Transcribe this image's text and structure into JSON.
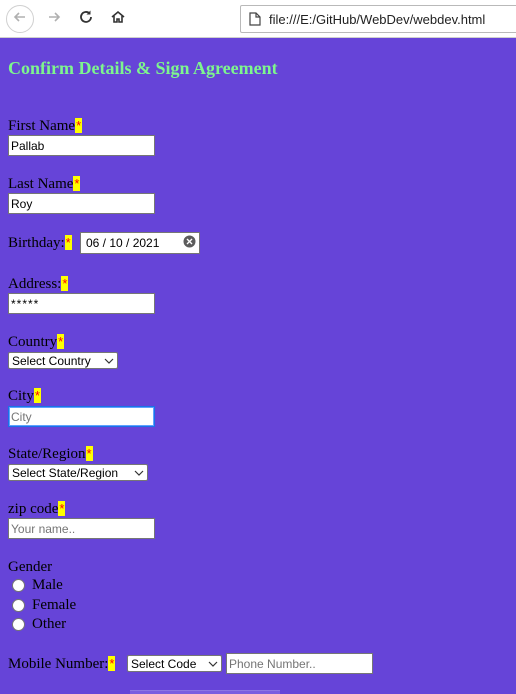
{
  "browser": {
    "url": "file:///E:/GitHub/WebDev/webdev.html",
    "icons": [
      "back-arrow-icon",
      "forward-arrow-icon",
      "reload-icon",
      "home-icon",
      "page-icon"
    ]
  },
  "form": {
    "title": "Confirm Details & Sign Agreement",
    "required_mark": "*",
    "first_name": {
      "label": "First Name",
      "value": "Pallab"
    },
    "last_name": {
      "label": "Last Name",
      "value": "Roy"
    },
    "birthday": {
      "label": "Birthday:",
      "value": "06 / 10 / 2021"
    },
    "address": {
      "label": "Address:",
      "value": "*****"
    },
    "country": {
      "label": "Country",
      "selected": "Select Country"
    },
    "city": {
      "label": "City",
      "placeholder": "City"
    },
    "state": {
      "label": "State/Region",
      "selected": "Select State/Region"
    },
    "zip": {
      "label": "zip code",
      "placeholder": "Your name.."
    },
    "gender": {
      "label": "Gender",
      "options": [
        "Male",
        "Female",
        "Other"
      ]
    },
    "mobile": {
      "label": "Mobile Number:",
      "code_selected": "Select Code",
      "placeholder": "Phone Number.."
    }
  },
  "colors": {
    "background": "#6644d8",
    "title": "#7ef58e",
    "required_bg": "#ffff00",
    "required_fg": "#ff0000"
  }
}
